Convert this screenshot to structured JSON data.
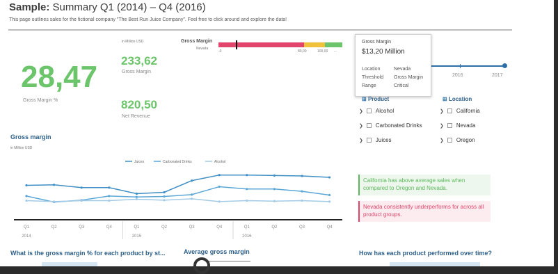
{
  "header": {
    "title_bold": "Sample:",
    "title_rest": "Summary Q1 (2014) – Q4 (2016)",
    "subtitle": "This page outlines sales for the fictional company \"The Best Run Juice Company\". Feel free to click around and explore the data!"
  },
  "kpis": {
    "unit": "in Million USD",
    "big_value": "28,47",
    "big_label": "Gross Margin %",
    "gm_value": "233,62",
    "gm_label": "Gross Margin",
    "nr_value": "820,50",
    "nr_label": "Net Revenue"
  },
  "bullet": {
    "title": "Gross Margin",
    "subtitle": "Nevada",
    "scale_min": "-0",
    "label_80": "80,00",
    "label_100": "100,00",
    "label_max": "...",
    "value_fraction": 0.14,
    "colors": {
      "critical": "#e2456b",
      "warning": "#f0c23c",
      "good": "#6cc56a",
      "marker": "#111111"
    }
  },
  "tooltip": {
    "title": "Gross Margin",
    "value": "$13,20 Million",
    "rows": [
      {
        "key": "Location",
        "val": "Nevada"
      },
      {
        "key": "Threshold",
        "val": "Gross Margin"
      },
      {
        "key": "Range",
        "val": "Critical"
      }
    ]
  },
  "timeline": {
    "labels": [
      "2016",
      "2017"
    ],
    "color": "#2d6fa8"
  },
  "filters": {
    "product": {
      "title": "Product",
      "items": [
        "Alcohol",
        "Carbonated Drinks",
        "Juices"
      ]
    },
    "location": {
      "title": "Location",
      "items": [
        "California",
        "Nevada",
        "Oregon"
      ]
    }
  },
  "line_chart": {
    "title": "Gross margin",
    "unit": "in Million USD",
    "legend": [
      "Juices",
      "Carbonated Drinks",
      "Alcohol"
    ]
  },
  "chart_data": {
    "type": "line",
    "title": "Gross margin",
    "xlabel": "",
    "ylabel": "",
    "categories": [
      "Q1",
      "Q2",
      "Q3",
      "Q4",
      "Q1",
      "Q2",
      "Q3",
      "Q4",
      "Q1",
      "Q2",
      "Q3",
      "Q4"
    ],
    "year_labels": [
      {
        "label": "2014",
        "index": 0
      },
      {
        "label": "2015",
        "index": 4
      },
      {
        "label": "2016",
        "index": 8
      }
    ],
    "ylim": [
      0,
      10
    ],
    "grid": false,
    "legend_position": "top",
    "series": [
      {
        "name": "Juices",
        "color": "#3f8fc4",
        "values": [
          6.8,
          6.9,
          6.3,
          6.3,
          5.0,
          5.3,
          7.8,
          9.0,
          9.0,
          8.9,
          8.8,
          8.5
        ]
      },
      {
        "name": "Carbonated Drinks",
        "color": "#5ba7d8",
        "values": [
          4.5,
          3.2,
          3.6,
          4.5,
          4.3,
          4.4,
          4.8,
          6.5,
          6.0,
          6.0,
          5.5,
          4.7
        ]
      },
      {
        "name": "Alcohol",
        "color": "#a3cbe6",
        "values": [
          3.5,
          3.3,
          3.5,
          3.5,
          3.8,
          3.6,
          3.9,
          3.3,
          3.5,
          3.4,
          3.5,
          3.3
        ]
      }
    ]
  },
  "callouts": {
    "positive": {
      "text": "California has above average sales when compared to Oregon and Nevada.",
      "color": "#5cb85c"
    },
    "negative": {
      "text": "Nevada consistently underperforms for across all product groups.",
      "color": "#e2456b"
    }
  },
  "bottom": {
    "q1": "What is the gross margin % for each product by st...",
    "q2": "Average gross margin",
    "q3": "How has each product performed over time?"
  }
}
